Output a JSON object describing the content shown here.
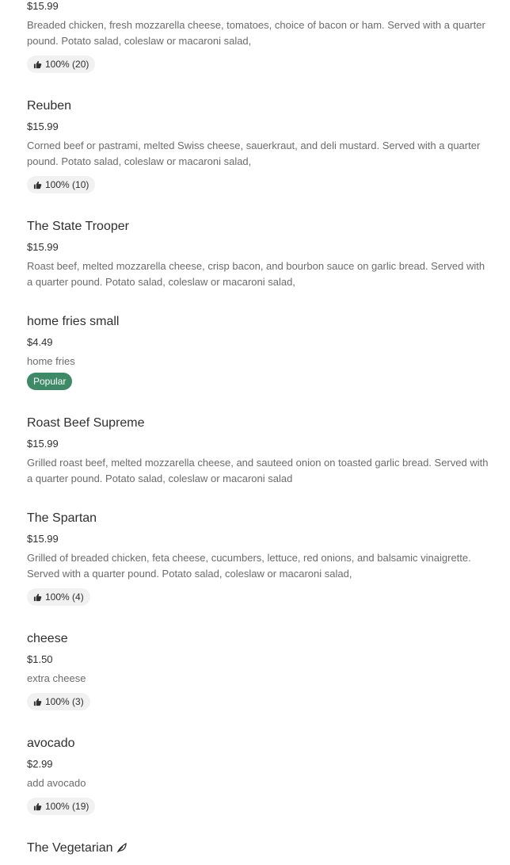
{
  "items": [
    {
      "price": "$15.99",
      "description": "Breaded chicken, fresh mozzarella cheese, tomatoes, choice of bacon or ham. Served with a quarter pound. Potato salad, coleslaw or macaroni salad,",
      "rating": "100% (20)"
    },
    {
      "name": "Reuben",
      "price": "$15.99",
      "description": "Corned beef or pastrami, melted Swiss cheese, sauerkraut, and deli mustard. Served with a quarter pound. Potato salad, coleslaw or macaroni salad,",
      "rating": "100% (10)"
    },
    {
      "name": "The State Trooper",
      "price": "$15.99",
      "description": "Roast beef, melted mozzarella cheese, crisp bacon, and bourbon sauce on garlic bread. Served with a quarter pound. Potato salad, coleslaw or macaroni salad,"
    },
    {
      "name": "home fries small",
      "price": "$4.49",
      "description": "home fries",
      "popular": "Popular"
    },
    {
      "name": "Roast Beef Supreme",
      "price": "$15.99",
      "description": "Grilled roast beef, melted mozzarella cheese, and sauteed onion on toasted garlic bread. Served with a quarter pound. Potato salad, coleslaw or macaroni salad"
    },
    {
      "name": "The Spartan",
      "price": "$15.99",
      "description": "Grilled of breaded chicken, feta cheese, cucumbers, lettuce, red onions, and balsamic vinaigrette. Served with a quarter pound. Potato salad, coleslaw or macaroni salad,",
      "rating": "100% (4)"
    },
    {
      "name": "cheese",
      "price": "$1.50",
      "description": "extra cheese",
      "rating": "100% (3)"
    },
    {
      "name": "avocado",
      "price": "$2.99",
      "description": "add avocado",
      "rating": "100% (19)"
    },
    {
      "name": "The Vegetarian",
      "icon": "leaf-icon"
    }
  ],
  "colors": {
    "text_primary": "#2f2f2f",
    "text_secondary": "#6b6b6b",
    "badge_bg": "#f1f1f1",
    "popular_bg": "#3f8a66"
  }
}
